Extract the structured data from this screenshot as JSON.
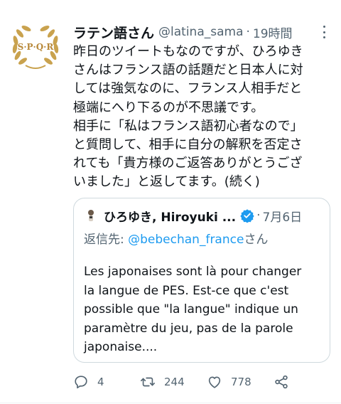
{
  "tweet": {
    "author": {
      "display_name": "ラテン語さん",
      "handle": "@latina_sama",
      "avatar_text": "S·P·Q·R"
    },
    "separator": "·",
    "time": "19時間",
    "body_lines": [
      "昨日のツイートもなのですが、ひろゆき",
      "さんはフランス語の話題だと日本人に対",
      "しては強気なのに、フランス人相手だと",
      "極端にへり下るのが不思議です。",
      "相手に「私はフランス語初心者なので」",
      "と質問して、相手に自分の解釈を否定さ",
      "れても「貴方様のご返答ありがとうござ",
      "いました」と返してます。(続く)"
    ]
  },
  "quote": {
    "display_name": "ひろゆき, Hiroyuki ...",
    "verified": true,
    "time": "7月6日",
    "reply_to_prefix": "返信先: ",
    "reply_to_handle": "@bebechan_france",
    "reply_to_suffix": "さん",
    "text_lines": [
      "Les japonaises sont là pour changer",
      "la langue de PES. Est-ce que c'est",
      "possible que \"la langue\" indique un",
      "paramètre du jeu, pas de la parole",
      "japonaise...."
    ]
  },
  "actions": {
    "reply_count": "4",
    "retweet_count": "244",
    "like_count": "778",
    "icons": [
      "reply-icon",
      "retweet-icon",
      "like-icon",
      "share-icon"
    ]
  },
  "colors": {
    "text": "#0f1419",
    "secondary": "#536471",
    "link": "#1d9bf0",
    "avatar_gold": "#b8893a"
  }
}
